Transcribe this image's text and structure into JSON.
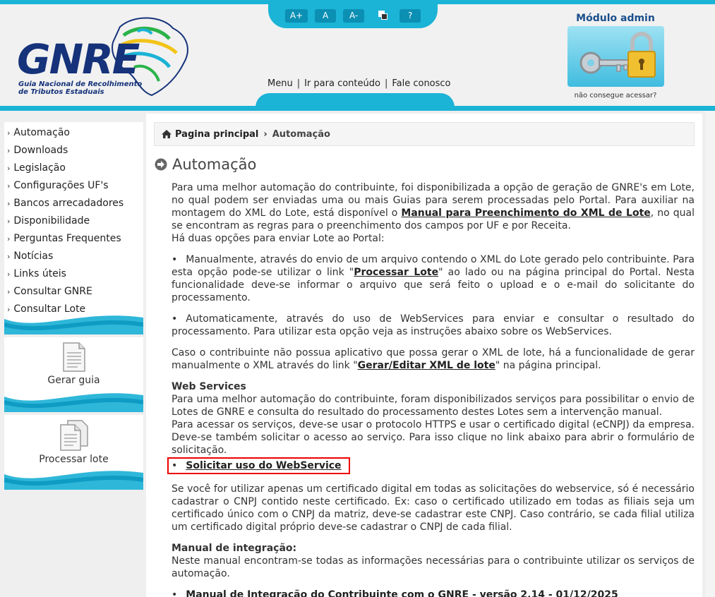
{
  "accessibility": {
    "increase": "A+",
    "normal": "A",
    "decrease": "A-",
    "help": "?"
  },
  "logo": {
    "name": "GNRE",
    "subtitle": "Guia Nacional de Recolhimento\nde Tributos Estaduais"
  },
  "topnav": {
    "menu": "Menu",
    "skip": "Ir para conteúdo",
    "contact": "Fale conosco"
  },
  "admin": {
    "title": "Módulo admin",
    "help": "não consegue acessar?"
  },
  "sidebar": {
    "items": [
      {
        "label": "Automação"
      },
      {
        "label": "Downloads"
      },
      {
        "label": "Legislação"
      },
      {
        "label": "Configurações UF's"
      },
      {
        "label": "Bancos arrecadadores"
      },
      {
        "label": "Disponibilidade"
      },
      {
        "label": "Perguntas Frequentes"
      },
      {
        "label": "Notícias"
      },
      {
        "label": "Links úteis"
      },
      {
        "label": "Consultar GNRE"
      },
      {
        "label": "Consultar Lote"
      }
    ],
    "boxes": [
      {
        "label": "Gerar guia"
      },
      {
        "label": "Processar lote"
      }
    ]
  },
  "breadcrumb": {
    "home": "Pagina principal",
    "current": "Automação"
  },
  "page": {
    "title": "Automação",
    "intro_a": "Para uma melhor automação do contribuinte, foi disponibilizada a opção de geração de GNRE's em Lote, no qual podem ser enviadas uma ou mais Guias para serem processadas pelo Portal. Para auxiliar na montagem do XML do Lote, está disponível o ",
    "intro_link": "Manual para Preenchimento do XML de Lote",
    "intro_b": ", no qual se encontram as regras para o preenchimento dos campos por UF e por Receita.",
    "intro_c": "Há duas opções para enviar Lote ao Portal:",
    "bullet1_a": "Manualmente, através do envio de um arquivo contendo o XML do Lote gerado pelo contribuinte. Para esta opção pode-se utilizar o link \"",
    "bullet1_link": "Processar Lote",
    "bullet1_b": "\" ao lado ou na página principal do Portal. Nesta funcionalidade deve-se informar o arquivo que será feito o upload e o e-mail do solicitante do processamento.",
    "bullet2": "Automaticamente, através do uso de WebServices para enviar e consultar o resultado do processamento. Para utilizar esta opção veja as instruções abaixo sobre os WebServices.",
    "para3_a": "Caso o contribuinte não possua aplicativo que possa gerar o XML de lote, há a funcionalidade de gerar manualmente o XML através do link \"",
    "para3_link": "Gerar/Editar XML de lote",
    "para3_b": "\" na página principal.",
    "ws_title": "Web Services",
    "ws_p1": "Para uma melhor automação do contribuinte, foram disponibilizados serviços para possibilitar o envio de Lotes de GNRE e consulta do resultado do processamento destes Lotes sem a intervenção manual.",
    "ws_p2": "Para acessar os serviços, deve-se usar o protocolo HTTPS e usar o certificado digital (eCNPJ) da empresa. Deve-se também solicitar o acesso ao serviço. Para isso clique no link abaixo para abrir o formulário de solicitação.",
    "ws_link": "Solicitar uso do WebService",
    "ws_p3": "Se você for utilizar apenas um certificado digital em todas as solicitações do webservice, só é necessário cadastrar o CNPJ contido neste certificado. Ex: caso o certificado utilizado em todas as filiais seja um certificado único com o CNPJ da matriz, deve-se cadastrar este CNPJ. Caso contrário, se cada filial utiliza um certificado digital próprio deve-se cadastrar o CNPJ de cada filial.",
    "manual_title": "Manual de integração:",
    "manual_p": "Neste manual encontram-se todas as informações necessárias para o contribuinte utilizar os serviços de automação.",
    "manual_link": "Manual de Integração do Contribuinte com o GNRE - versão 2.14 - 01/12/2025"
  }
}
